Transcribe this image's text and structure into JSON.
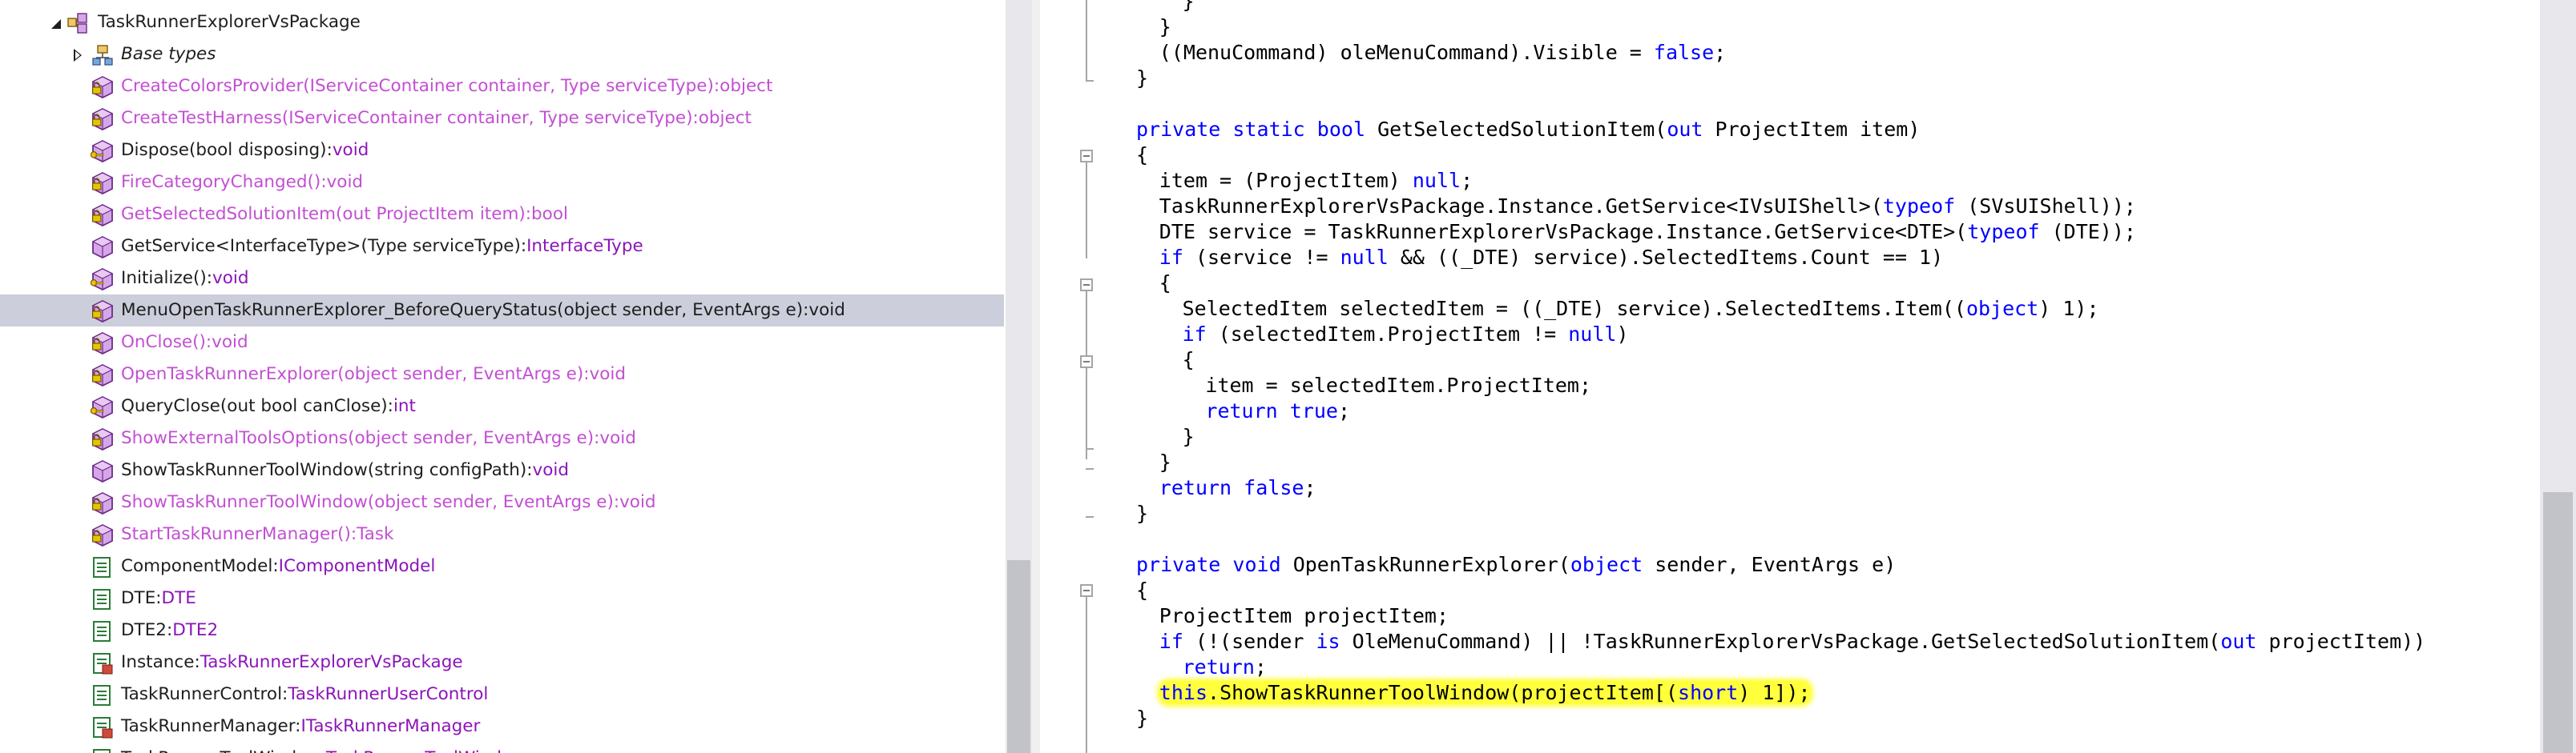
{
  "tree": {
    "rows": [
      {
        "expander": "expanded",
        "icon": "package-class-icon",
        "segments": [
          {
            "text": "TaskRunnerExplorerVsPackage",
            "style": "dark"
          }
        ]
      },
      {
        "expander": "collapsed",
        "icon": "base-types-icon",
        "segments": [
          {
            "text": "Base types",
            "style": "italic"
          }
        ]
      },
      {
        "icon": "private-method-icon",
        "segments": [
          {
            "text": "CreateColorsProvider(IServiceContainer container, Type serviceType):object",
            "style": "muted"
          }
        ]
      },
      {
        "icon": "private-method-icon",
        "segments": [
          {
            "text": "CreateTestHarness(IServiceContainer container, Type serviceType):object",
            "style": "muted"
          }
        ]
      },
      {
        "icon": "protected-method-icon",
        "segments": [
          {
            "text": "Dispose(bool disposing):",
            "style": "dark"
          },
          {
            "text": "void",
            "style": "type"
          }
        ]
      },
      {
        "icon": "private-method-icon",
        "segments": [
          {
            "text": "FireCategoryChanged():void",
            "style": "muted"
          }
        ]
      },
      {
        "icon": "private-method-icon",
        "segments": [
          {
            "text": "GetSelectedSolutionItem(out ProjectItem item):bool",
            "style": "muted"
          }
        ]
      },
      {
        "icon": "public-method-icon",
        "segments": [
          {
            "text": "GetService<InterfaceType>(Type serviceType):",
            "style": "dark"
          },
          {
            "text": "InterfaceType",
            "style": "type"
          }
        ]
      },
      {
        "icon": "protected-method-icon",
        "segments": [
          {
            "text": "Initialize():",
            "style": "dark"
          },
          {
            "text": "void",
            "style": "type"
          }
        ]
      },
      {
        "icon": "private-method-icon",
        "selected": true,
        "segments": [
          {
            "text": "MenuOpenTaskRunnerExplorer_BeforeQueryStatus(object sender, EventArgs e):void",
            "style": "dark"
          }
        ]
      },
      {
        "icon": "private-method-icon",
        "segments": [
          {
            "text": "OnClose():void",
            "style": "muted"
          }
        ]
      },
      {
        "icon": "private-method-icon",
        "segments": [
          {
            "text": "OpenTaskRunnerExplorer(object sender, EventArgs e):void",
            "style": "muted"
          }
        ]
      },
      {
        "icon": "protected-method-icon",
        "segments": [
          {
            "text": "QueryClose(out bool canClose):",
            "style": "dark"
          },
          {
            "text": "int",
            "style": "type"
          }
        ]
      },
      {
        "icon": "private-method-icon",
        "segments": [
          {
            "text": "ShowExternalToolsOptions(object sender, EventArgs e):void",
            "style": "muted"
          }
        ]
      },
      {
        "icon": "public-method-icon",
        "segments": [
          {
            "text": "ShowTaskRunnerToolWindow(string configPath):",
            "style": "dark"
          },
          {
            "text": "void",
            "style": "type"
          }
        ]
      },
      {
        "icon": "private-method-icon",
        "segments": [
          {
            "text": "ShowTaskRunnerToolWindow(object sender, EventArgs e):void",
            "style": "muted"
          }
        ]
      },
      {
        "icon": "private-method-icon",
        "segments": [
          {
            "text": "StartTaskRunnerManager():Task",
            "style": "muted"
          }
        ]
      },
      {
        "icon": "property-icon",
        "segments": [
          {
            "text": "ComponentModel:",
            "style": "dark"
          },
          {
            "text": "IComponentModel",
            "style": "type"
          }
        ]
      },
      {
        "icon": "property-icon",
        "segments": [
          {
            "text": "DTE:",
            "style": "dark"
          },
          {
            "text": "DTE",
            "style": "type"
          }
        ]
      },
      {
        "icon": "property-icon",
        "segments": [
          {
            "text": "DTE2:",
            "style": "dark"
          },
          {
            "text": "DTE2",
            "style": "type"
          }
        ]
      },
      {
        "icon": "static-property-icon",
        "segments": [
          {
            "text": "Instance:",
            "style": "dark"
          },
          {
            "text": "TaskRunnerExplorerVsPackage",
            "style": "type"
          }
        ]
      },
      {
        "icon": "property-icon",
        "segments": [
          {
            "text": "TaskRunnerControl:",
            "style": "dark"
          },
          {
            "text": "TaskRunnerUserControl",
            "style": "type"
          }
        ]
      },
      {
        "icon": "static-property-icon",
        "segments": [
          {
            "text": "TaskRunnerManager:",
            "style": "dark"
          },
          {
            "text": "ITaskRunnerManager",
            "style": "type"
          }
        ]
      },
      {
        "icon": "property-icon",
        "segments": [
          {
            "text": "TaskRunnerToolWindow:",
            "style": "dark"
          },
          {
            "text": "TaskRunnerToolWindow",
            "style": "type"
          }
        ]
      }
    ]
  },
  "code": {
    "lines": [
      {
        "indent": 4,
        "tokens": [
          {
            "t": "}"
          }
        ]
      },
      {
        "indent": 2,
        "tokens": [
          {
            "t": "}"
          }
        ]
      },
      {
        "indent": 2,
        "tokens": [
          {
            "t": "((MenuCommand) oleMenuCommand).Visible = "
          },
          {
            "t": "false",
            "k": "kw"
          },
          {
            "t": ";"
          }
        ]
      },
      {
        "indent": 0,
        "tokens": [
          {
            "t": "}"
          }
        ]
      },
      {
        "indent": 0,
        "tokens": []
      },
      {
        "indent": 0,
        "tokens": [
          {
            "t": "private",
            "k": "kw"
          },
          {
            "t": " "
          },
          {
            "t": "static",
            "k": "kw"
          },
          {
            "t": " "
          },
          {
            "t": "bool",
            "k": "kw"
          },
          {
            "t": " GetSelectedSolutionItem("
          },
          {
            "t": "out",
            "k": "kw"
          },
          {
            "t": " ProjectItem item)"
          }
        ]
      },
      {
        "indent": 0,
        "tokens": [
          {
            "t": "{"
          }
        ]
      },
      {
        "indent": 2,
        "tokens": [
          {
            "t": "item = (ProjectItem) "
          },
          {
            "t": "null",
            "k": "kw"
          },
          {
            "t": ";"
          }
        ]
      },
      {
        "indent": 2,
        "tokens": [
          {
            "t": "TaskRunnerExplorerVsPackage.Instance.GetService<IVsUIShell>("
          },
          {
            "t": "typeof",
            "k": "kw"
          },
          {
            "t": " (SVsUIShell));"
          }
        ]
      },
      {
        "indent": 2,
        "tokens": [
          {
            "t": "DTE service = TaskRunnerExplorerVsPackage.Instance.GetService<DTE>("
          },
          {
            "t": "typeof",
            "k": "kw"
          },
          {
            "t": " (DTE));"
          }
        ]
      },
      {
        "indent": 2,
        "tokens": [
          {
            "t": "if",
            "k": "kw"
          },
          {
            "t": " (service != "
          },
          {
            "t": "null",
            "k": "kw"
          },
          {
            "t": " && ((_DTE) service).SelectedItems.Count == 1)"
          }
        ]
      },
      {
        "indent": 2,
        "tokens": [
          {
            "t": "{"
          }
        ]
      },
      {
        "indent": 4,
        "tokens": [
          {
            "t": "SelectedItem selectedItem = ((_DTE) service).SelectedItems.Item(("
          },
          {
            "t": "object",
            "k": "kw"
          },
          {
            "t": ") 1);"
          }
        ]
      },
      {
        "indent": 4,
        "tokens": [
          {
            "t": "if",
            "k": "kw"
          },
          {
            "t": " (selectedItem.ProjectItem != "
          },
          {
            "t": "null",
            "k": "kw"
          },
          {
            "t": ")"
          }
        ]
      },
      {
        "indent": 4,
        "tokens": [
          {
            "t": "{"
          }
        ]
      },
      {
        "indent": 6,
        "tokens": [
          {
            "t": "item = selectedItem.ProjectItem;"
          }
        ]
      },
      {
        "indent": 6,
        "tokens": [
          {
            "t": "return",
            "k": "kw"
          },
          {
            "t": " "
          },
          {
            "t": "true",
            "k": "kw"
          },
          {
            "t": ";"
          }
        ]
      },
      {
        "indent": 4,
        "tokens": [
          {
            "t": "}"
          }
        ]
      },
      {
        "indent": 2,
        "tokens": [
          {
            "t": "}"
          }
        ]
      },
      {
        "indent": 2,
        "tokens": [
          {
            "t": "return",
            "k": "kw"
          },
          {
            "t": " "
          },
          {
            "t": "false",
            "k": "kw"
          },
          {
            "t": ";"
          }
        ]
      },
      {
        "indent": 0,
        "tokens": [
          {
            "t": "}"
          }
        ]
      },
      {
        "indent": 0,
        "tokens": []
      },
      {
        "indent": 0,
        "tokens": [
          {
            "t": "private",
            "k": "kw"
          },
          {
            "t": " "
          },
          {
            "t": "void",
            "k": "kw"
          },
          {
            "t": " OpenTaskRunnerExplorer("
          },
          {
            "t": "object",
            "k": "kw"
          },
          {
            "t": " sender, EventArgs e)"
          }
        ]
      },
      {
        "indent": 0,
        "tokens": [
          {
            "t": "{"
          }
        ]
      },
      {
        "indent": 2,
        "tokens": [
          {
            "t": "ProjectItem projectItem;"
          }
        ]
      },
      {
        "indent": 2,
        "tokens": [
          {
            "t": "if",
            "k": "kw"
          },
          {
            "t": " (!(sender "
          },
          {
            "t": "is",
            "k": "kw"
          },
          {
            "t": " OleMenuCommand) || !TaskRunnerExplorerVsPackage.GetSelectedSolutionItem("
          },
          {
            "t": "out",
            "k": "kw"
          },
          {
            "t": " projectItem))"
          }
        ]
      },
      {
        "indent": 4,
        "tokens": [
          {
            "t": "return",
            "k": "kw"
          },
          {
            "t": ";"
          }
        ]
      },
      {
        "indent": 2,
        "highlight": true,
        "tokens": [
          {
            "t": "this",
            "k": "kw"
          },
          {
            "t": ".ShowTaskRunnerToolWindow(projectItem[("
          },
          {
            "t": "short",
            "k": "kw"
          },
          {
            "t": ") 1]);"
          }
        ]
      },
      {
        "indent": 0,
        "tokens": [
          {
            "t": "}"
          }
        ]
      }
    ]
  }
}
